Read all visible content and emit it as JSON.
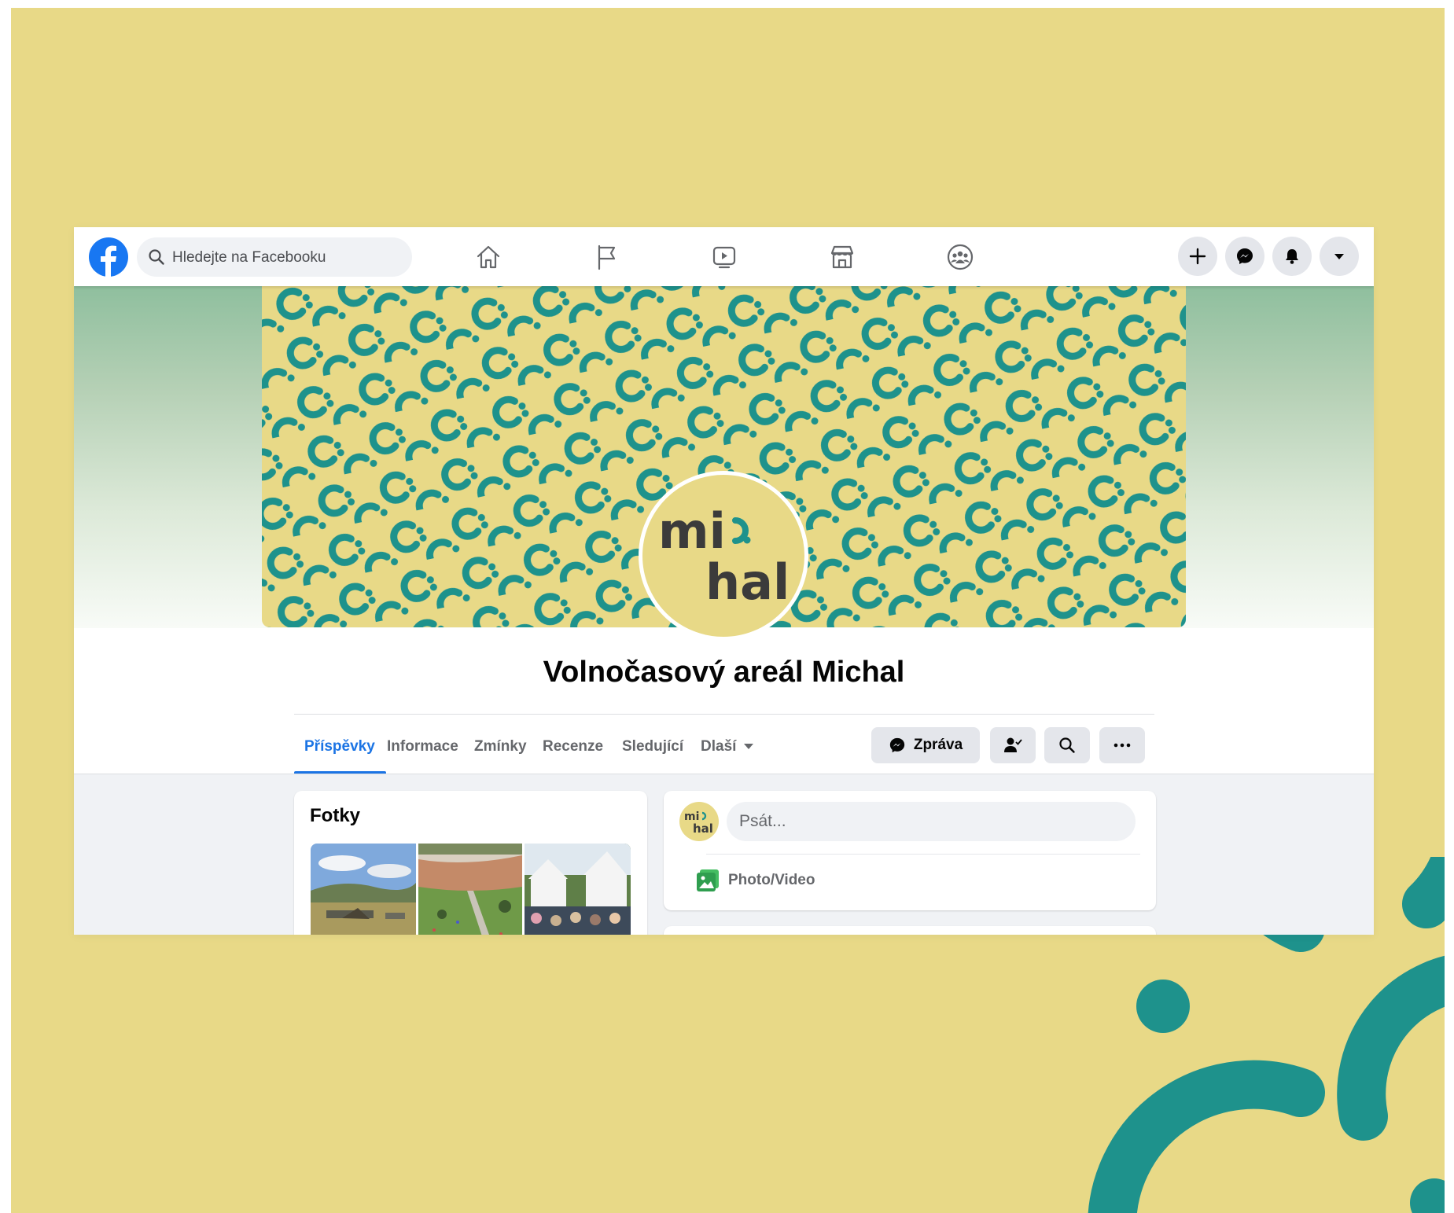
{
  "search": {
    "placeholder": "Hledejte na Facebooku"
  },
  "page": {
    "name": "Volnočasový areál Michal"
  },
  "logo": {
    "line1": "mi",
    "line2": "hal"
  },
  "tabs": [
    {
      "label": "Příspěvky",
      "active": true
    },
    {
      "label": "Informace"
    },
    {
      "label": "Zmínky"
    },
    {
      "label": "Recenze"
    },
    {
      "label": "Sledující"
    },
    {
      "label": "Dlaší"
    }
  ],
  "actions": {
    "message_label": "Zpráva"
  },
  "photos": {
    "title": "Fotky"
  },
  "composer": {
    "placeholder": "Psát...",
    "photo_video_label": "Photo/Video"
  },
  "colors": {
    "background": "#e8d987",
    "brand_teal": "#1e928c",
    "facebook_blue": "#1877f2",
    "active_tab": "#1b74e4"
  },
  "icons": [
    "facebook-logo",
    "search-icon",
    "home-icon",
    "flag-icon",
    "video-icon",
    "marketplace-icon",
    "groups-icon",
    "plus-icon",
    "messenger-icon",
    "bell-icon",
    "caret-down-icon",
    "add-friend-icon",
    "more-icon",
    "photo-icon"
  ]
}
